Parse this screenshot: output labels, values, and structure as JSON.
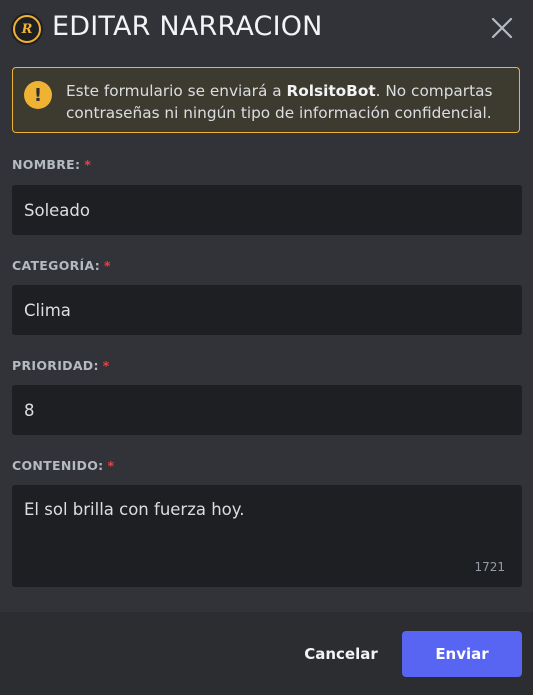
{
  "header": {
    "logo_text": "R",
    "title": "EDITAR NARRACION"
  },
  "notice": {
    "text_before": "Este formulario se enviará a ",
    "bot_name": "RolsitoBot",
    "text_after": ". No compartas contraseñas ni ningún tipo de información confidencial."
  },
  "fields": {
    "nombre": {
      "label": "NOMBRE:",
      "required_mark": "*",
      "value": "Soleado"
    },
    "categoria": {
      "label": "CATEGORÍA:",
      "required_mark": "*",
      "value": "Clima"
    },
    "prioridad": {
      "label": "PRIORIDAD:",
      "required_mark": "*",
      "value": "8"
    },
    "contenido": {
      "label": "CONTENIDO:",
      "required_mark": "*",
      "value": "El sol brilla con fuerza hoy.",
      "counter": "1721"
    }
  },
  "footer": {
    "cancel_label": "Cancelar",
    "submit_label": "Enviar"
  },
  "colors": {
    "background": "#313338",
    "footer": "#2b2d31",
    "input": "#1e1f22",
    "warning": "#f0b232",
    "required": "#f23f43",
    "primary": "#5865f2"
  },
  "icons": {
    "close": "close-icon",
    "warning": "exclamation-icon",
    "logo": "bot-logo-icon"
  }
}
